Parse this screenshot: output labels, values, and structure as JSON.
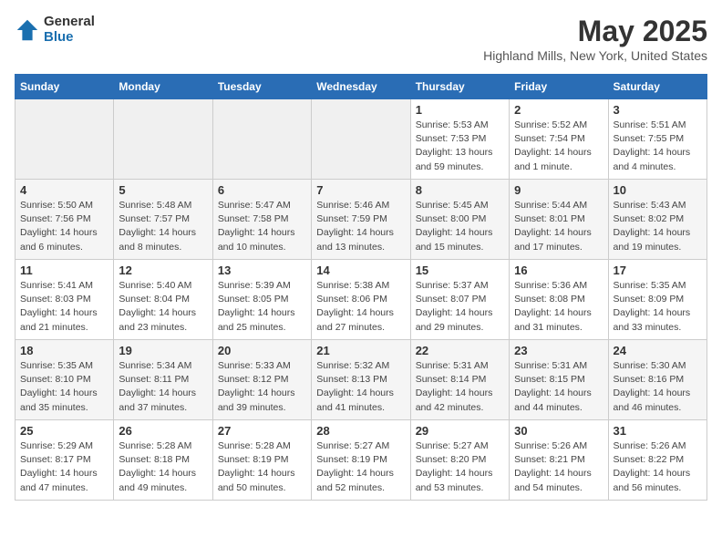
{
  "logo": {
    "general": "General",
    "blue": "Blue"
  },
  "title": "May 2025",
  "subtitle": "Highland Mills, New York, United States",
  "days_header": [
    "Sunday",
    "Monday",
    "Tuesday",
    "Wednesday",
    "Thursday",
    "Friday",
    "Saturday"
  ],
  "weeks": [
    [
      {
        "day": "",
        "detail": ""
      },
      {
        "day": "",
        "detail": ""
      },
      {
        "day": "",
        "detail": ""
      },
      {
        "day": "",
        "detail": ""
      },
      {
        "day": "1",
        "detail": "Sunrise: 5:53 AM\nSunset: 7:53 PM\nDaylight: 13 hours\nand 59 minutes."
      },
      {
        "day": "2",
        "detail": "Sunrise: 5:52 AM\nSunset: 7:54 PM\nDaylight: 14 hours\nand 1 minute."
      },
      {
        "day": "3",
        "detail": "Sunrise: 5:51 AM\nSunset: 7:55 PM\nDaylight: 14 hours\nand 4 minutes."
      }
    ],
    [
      {
        "day": "4",
        "detail": "Sunrise: 5:50 AM\nSunset: 7:56 PM\nDaylight: 14 hours\nand 6 minutes."
      },
      {
        "day": "5",
        "detail": "Sunrise: 5:48 AM\nSunset: 7:57 PM\nDaylight: 14 hours\nand 8 minutes."
      },
      {
        "day": "6",
        "detail": "Sunrise: 5:47 AM\nSunset: 7:58 PM\nDaylight: 14 hours\nand 10 minutes."
      },
      {
        "day": "7",
        "detail": "Sunrise: 5:46 AM\nSunset: 7:59 PM\nDaylight: 14 hours\nand 13 minutes."
      },
      {
        "day": "8",
        "detail": "Sunrise: 5:45 AM\nSunset: 8:00 PM\nDaylight: 14 hours\nand 15 minutes."
      },
      {
        "day": "9",
        "detail": "Sunrise: 5:44 AM\nSunset: 8:01 PM\nDaylight: 14 hours\nand 17 minutes."
      },
      {
        "day": "10",
        "detail": "Sunrise: 5:43 AM\nSunset: 8:02 PM\nDaylight: 14 hours\nand 19 minutes."
      }
    ],
    [
      {
        "day": "11",
        "detail": "Sunrise: 5:41 AM\nSunset: 8:03 PM\nDaylight: 14 hours\nand 21 minutes."
      },
      {
        "day": "12",
        "detail": "Sunrise: 5:40 AM\nSunset: 8:04 PM\nDaylight: 14 hours\nand 23 minutes."
      },
      {
        "day": "13",
        "detail": "Sunrise: 5:39 AM\nSunset: 8:05 PM\nDaylight: 14 hours\nand 25 minutes."
      },
      {
        "day": "14",
        "detail": "Sunrise: 5:38 AM\nSunset: 8:06 PM\nDaylight: 14 hours\nand 27 minutes."
      },
      {
        "day": "15",
        "detail": "Sunrise: 5:37 AM\nSunset: 8:07 PM\nDaylight: 14 hours\nand 29 minutes."
      },
      {
        "day": "16",
        "detail": "Sunrise: 5:36 AM\nSunset: 8:08 PM\nDaylight: 14 hours\nand 31 minutes."
      },
      {
        "day": "17",
        "detail": "Sunrise: 5:35 AM\nSunset: 8:09 PM\nDaylight: 14 hours\nand 33 minutes."
      }
    ],
    [
      {
        "day": "18",
        "detail": "Sunrise: 5:35 AM\nSunset: 8:10 PM\nDaylight: 14 hours\nand 35 minutes."
      },
      {
        "day": "19",
        "detail": "Sunrise: 5:34 AM\nSunset: 8:11 PM\nDaylight: 14 hours\nand 37 minutes."
      },
      {
        "day": "20",
        "detail": "Sunrise: 5:33 AM\nSunset: 8:12 PM\nDaylight: 14 hours\nand 39 minutes."
      },
      {
        "day": "21",
        "detail": "Sunrise: 5:32 AM\nSunset: 8:13 PM\nDaylight: 14 hours\nand 41 minutes."
      },
      {
        "day": "22",
        "detail": "Sunrise: 5:31 AM\nSunset: 8:14 PM\nDaylight: 14 hours\nand 42 minutes."
      },
      {
        "day": "23",
        "detail": "Sunrise: 5:31 AM\nSunset: 8:15 PM\nDaylight: 14 hours\nand 44 minutes."
      },
      {
        "day": "24",
        "detail": "Sunrise: 5:30 AM\nSunset: 8:16 PM\nDaylight: 14 hours\nand 46 minutes."
      }
    ],
    [
      {
        "day": "25",
        "detail": "Sunrise: 5:29 AM\nSunset: 8:17 PM\nDaylight: 14 hours\nand 47 minutes."
      },
      {
        "day": "26",
        "detail": "Sunrise: 5:28 AM\nSunset: 8:18 PM\nDaylight: 14 hours\nand 49 minutes."
      },
      {
        "day": "27",
        "detail": "Sunrise: 5:28 AM\nSunset: 8:19 PM\nDaylight: 14 hours\nand 50 minutes."
      },
      {
        "day": "28",
        "detail": "Sunrise: 5:27 AM\nSunset: 8:19 PM\nDaylight: 14 hours\nand 52 minutes."
      },
      {
        "day": "29",
        "detail": "Sunrise: 5:27 AM\nSunset: 8:20 PM\nDaylight: 14 hours\nand 53 minutes."
      },
      {
        "day": "30",
        "detail": "Sunrise: 5:26 AM\nSunset: 8:21 PM\nDaylight: 14 hours\nand 54 minutes."
      },
      {
        "day": "31",
        "detail": "Sunrise: 5:26 AM\nSunset: 8:22 PM\nDaylight: 14 hours\nand 56 minutes."
      }
    ]
  ]
}
